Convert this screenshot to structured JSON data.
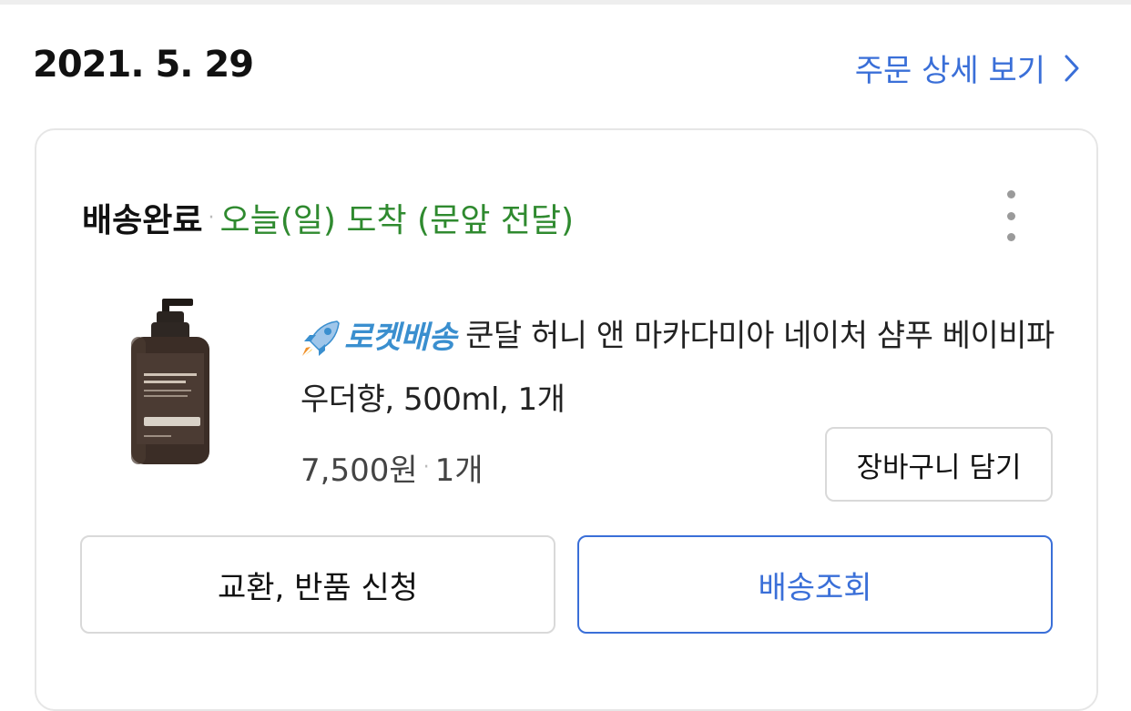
{
  "order": {
    "date": "2021. 5. 29",
    "detail_link_label": "주문 상세 보기"
  },
  "delivery": {
    "status": "배송완료",
    "separator": "·",
    "arrival_text": "오늘(일) 도착 (문앞 전달)"
  },
  "product": {
    "badge_label": "로켓배송",
    "badge_icon": "rocket-icon",
    "name": "쿤달 허니 앤 마카다미아 네이처 샴푸 베이비파우더향, 500ml, 1개",
    "price": "7,500원",
    "price_separator": "·",
    "quantity": "1개"
  },
  "actions": {
    "add_to_cart_label": "장바구니 담기",
    "return_exchange_label": "교환, 반품 신청",
    "track_delivery_label": "배송조회"
  },
  "colors": {
    "link_blue": "#3a6fd8",
    "status_green": "#2f8a2f",
    "rocket_blue": "#3a8fcf"
  }
}
